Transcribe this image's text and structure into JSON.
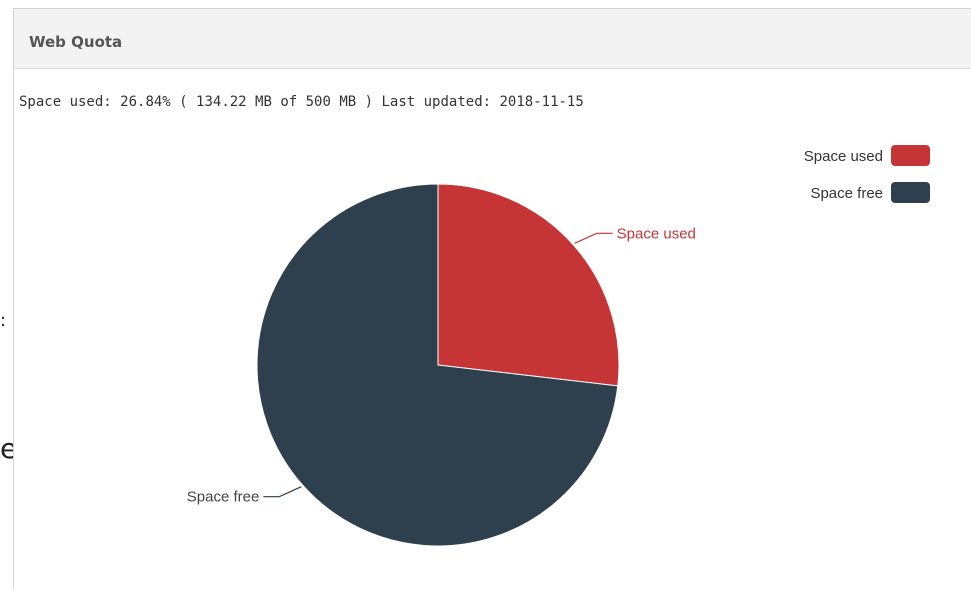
{
  "background_fragments": {
    "fragment_1": ":",
    "fragment_2": "eal"
  },
  "panel": {
    "title": "Web Quota",
    "summary": {
      "label": "Space used:",
      "percent": "26.84%",
      "detail": "( 134.22 MB of 500 MB )",
      "updated_label": "Last updated:",
      "updated_date": "2018-11-15"
    }
  },
  "colors": {
    "used": "#c63535",
    "free": "#2e3f4e",
    "header_bg": "#f3f3f3"
  },
  "chart_data": {
    "type": "pie",
    "title": "",
    "legend_position": "top-right",
    "slices": [
      {
        "label": "Space used",
        "value": 134.22,
        "color": "#c63535"
      },
      {
        "label": "Space free",
        "value": 365.78,
        "color": "#2e3f4e"
      }
    ]
  }
}
